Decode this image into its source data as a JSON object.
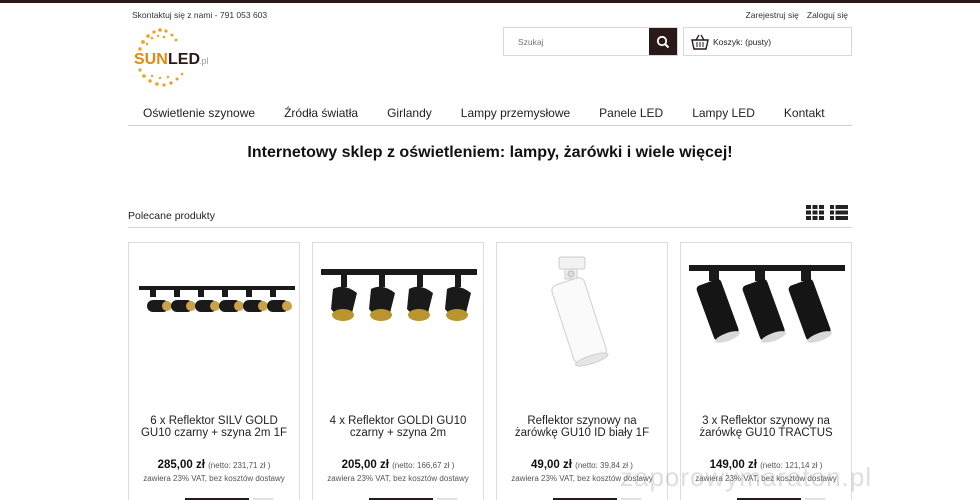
{
  "header": {
    "contact": "Skontaktuj się z nami - 791 053 603",
    "register": "Zarejestruj się",
    "login": "Zaloguj się",
    "logo_main": "SUNLED",
    "logo_suffix": ".pl"
  },
  "search": {
    "placeholder": "Szukaj"
  },
  "cart": {
    "label": "Koszyk: (pusty)"
  },
  "nav": [
    "Oświetlenie szynowe",
    "Źródła światła",
    "Girlandy",
    "Lampy przemysłowe",
    "Panele LED",
    "Lampy LED",
    "Kontakt"
  ],
  "headline": "Internetowy sklep z oświetleniem: lampy, żarówki i wiele więcej!",
  "section": {
    "title": "Polecane produkty"
  },
  "products": [
    {
      "name": "6 x Reflektor SILV GOLD GU10 czarny + szyna 2m 1F",
      "price": "285,00 zł",
      "net": "(netto: 231,71 zł )",
      "vat": "zawiera 23% VAT, bez kosztów dostawy"
    },
    {
      "name": "4 x Reflektor GOLDI GU10 czarny + szyna 2m",
      "price": "205,00 zł",
      "net": "(netto: 166,67 zł )",
      "vat": "zawiera 23% VAT, bez kosztów dostawy"
    },
    {
      "name": "Reflektor szynowy na żarówkę GU10 ID biały 1F",
      "price": "49,00 zł",
      "net": "(netto: 39,84 zł )",
      "vat": "zawiera 23% VAT, bez kosztów dostawy"
    },
    {
      "name": "3 x Reflektor szynowy na żarówkę GU10 TRACTUS",
      "price": "149,00 zł",
      "net": "(netto: 121,14 zł )",
      "vat": "zawiera 23% VAT, bez kosztów dostawy"
    }
  ],
  "watermark": "zaporowymaraton.pl",
  "colors": {
    "dark": "#2a1a17",
    "accent": "#f0a020",
    "border": "#dcdcdc"
  }
}
